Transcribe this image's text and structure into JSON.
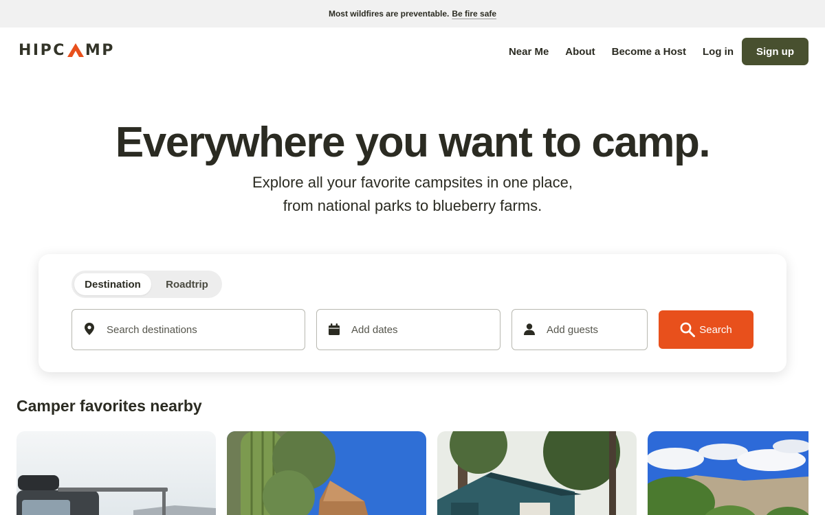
{
  "banner": {
    "text": "Most wildfires are preventable.",
    "link": "Be fire safe"
  },
  "brand": {
    "name_left": "HIPC",
    "name_right": "MP",
    "accent_color": "#e8501c"
  },
  "nav": {
    "links": [
      "Near Me",
      "About",
      "Become a Host",
      "Log in"
    ],
    "signup_label": "Sign up",
    "signup_color": "#48502f"
  },
  "hero": {
    "title": "Everywhere you want to camp.",
    "subtitle_line1": "Explore all your favorite campsites in one place,",
    "subtitle_line2": "from national parks to blueberry farms."
  },
  "search": {
    "modes": [
      "Destination",
      "Roadtrip"
    ],
    "active_mode": "Destination",
    "destination_placeholder": "Search destinations",
    "dates_placeholder": "Add dates",
    "guests_placeholder": "Add guests",
    "button_label": "Search",
    "icons": [
      "map-pin-icon",
      "calendar-icon",
      "person-icon",
      "search-icon"
    ]
  },
  "section": {
    "title": "Camper favorites nearby"
  }
}
